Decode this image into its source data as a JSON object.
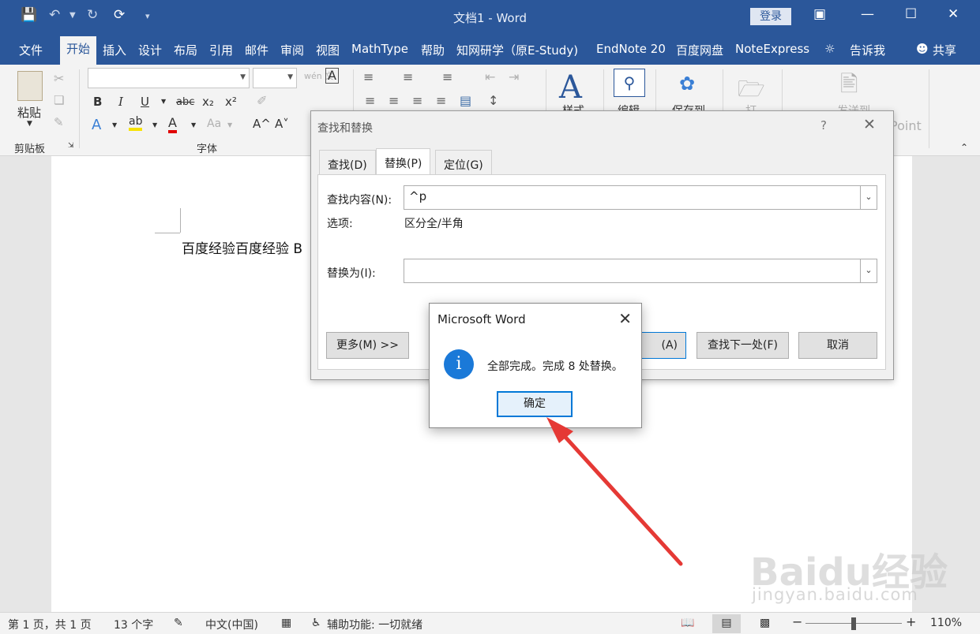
{
  "window": {
    "title": "文档1  -  Word",
    "login": "登录"
  },
  "tabs": [
    "文件",
    "开始",
    "插入",
    "设计",
    "布局",
    "引用",
    "邮件",
    "审阅",
    "视图",
    "MathType",
    "帮助",
    "知网研学（原E-Study)",
    "EndNote 20",
    "百度网盘",
    "NoteExpress",
    "告诉我",
    "共享"
  ],
  "ribbon": {
    "paste": "粘贴",
    "clipboard_group": "剪贴板",
    "font_group": "字体",
    "styles": "样式",
    "editing": "编辑",
    "save_to": "保存到",
    "open": "打",
    "send_to": "发送到",
    "point": "Point",
    "bold": "B",
    "italic": "I",
    "underline": "U",
    "strike": "abc",
    "sub": "x₂",
    "sup": "x²",
    "wen": "wén 文",
    "font_a": "A",
    "grow": "A^",
    "shrink": "A˅",
    "aa": "Aa"
  },
  "document": {
    "text": "百度经验百度经验 B"
  },
  "find_dialog": {
    "title": "查找和替换",
    "help": "?",
    "tabs": [
      "查找(D)",
      "替换(P)",
      "定位(G)"
    ],
    "find_label": "查找内容(N):",
    "find_value": "^p",
    "options_label": "选项:",
    "options_value": "区分全/半角",
    "replace_label": "替换为(I):",
    "replace_value": "",
    "more_button": "更多(M) >>",
    "replace_all_button": "(A)",
    "find_next_button": "查找下一处(F)",
    "cancel_button": "取消"
  },
  "message": {
    "title": "Microsoft Word",
    "text": "全部完成。完成 8 处替换。",
    "ok": "确定"
  },
  "status": {
    "page": "第 1 页，共 1 页",
    "words": "13 个字",
    "lang": "中文(中国)",
    "accessibility": "辅助功能: 一切就绪",
    "zoom": "110%"
  },
  "watermark": {
    "main": "Baidu经验",
    "sub": "jingyan.baidu.com"
  }
}
